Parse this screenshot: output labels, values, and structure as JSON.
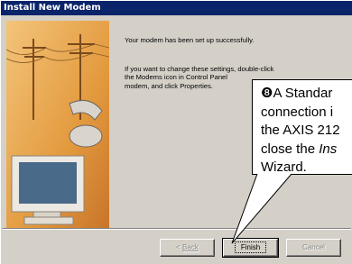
{
  "window": {
    "title": "Install New Modem"
  },
  "content": {
    "line1": "Your modem has been set up successfully.",
    "para2_line1": "If you want to change these settings, double-click",
    "para2_line2": "the Modems icon in Control Panel",
    "para2_line3": "modem, and click Properties."
  },
  "buttons": {
    "back_label": "Back",
    "back_prefix": "< ",
    "finish_label": "Finish",
    "cancel_label": "Cancel"
  },
  "callout": {
    "number": "❽",
    "line1": "A Standar",
    "line2": "connection i",
    "line3": "the AXIS 212",
    "line4_prefix": "close the ",
    "line4_italic": "Ins",
    "line5": "Wizard."
  }
}
